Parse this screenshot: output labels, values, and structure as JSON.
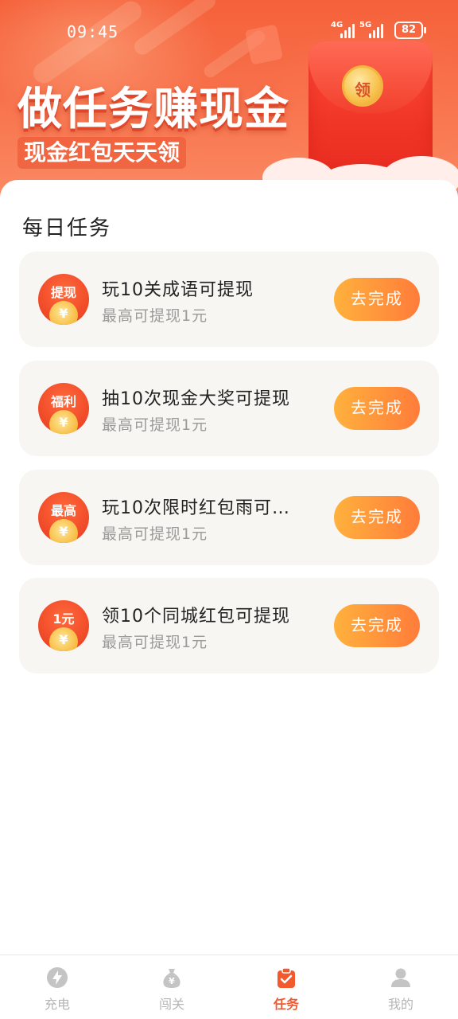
{
  "status_bar": {
    "time": "09:45",
    "network1": "4G",
    "network2": "5G",
    "battery": "82"
  },
  "banner": {
    "title": "做任务赚现金",
    "subtitle": "现金红包天天领",
    "envelope_coin": "领"
  },
  "section_title": "每日任务",
  "tasks": [
    {
      "badge": "提现",
      "title": "玩10关成语可提现",
      "subtitle": "最高可提现1元",
      "button": "去完成"
    },
    {
      "badge": "福利",
      "title": "抽10次现金大奖可提现",
      "subtitle": "最高可提现1元",
      "button": "去完成"
    },
    {
      "badge": "最高",
      "title": "玩10次限时红包雨可…",
      "subtitle": "最高可提现1元",
      "button": "去完成"
    },
    {
      "badge": "1元",
      "title": "领10个同城红包可提现",
      "subtitle": "最高可提现1元",
      "button": "去完成"
    }
  ],
  "coin_symbol": "¥",
  "tabs": [
    {
      "label": "充电",
      "icon": "lightning-icon",
      "active": false
    },
    {
      "label": "闯关",
      "icon": "money-bag-icon",
      "active": false
    },
    {
      "label": "任务",
      "icon": "clipboard-check-icon",
      "active": true
    },
    {
      "label": "我的",
      "icon": "user-icon",
      "active": false
    }
  ],
  "colors": {
    "accent": "#f2592e",
    "button_start": "#ffb13d",
    "button_end": "#ff7c3a",
    "inactive_tab": "#b5b5b5"
  }
}
